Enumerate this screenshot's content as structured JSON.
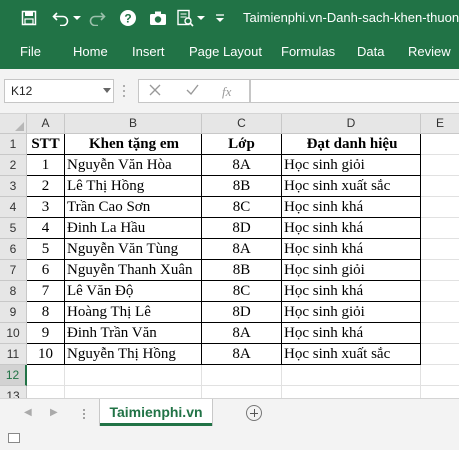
{
  "window": {
    "title": "Taimienphi.vn-Danh-sach-khen-thuong-",
    "quick_access": [
      "save-icon",
      "undo-icon",
      "redo-icon",
      "help-icon",
      "camera-icon",
      "print-preview-icon",
      "customize-icon"
    ]
  },
  "ribbon": {
    "tabs": [
      {
        "label": "File"
      },
      {
        "label": "Home"
      },
      {
        "label": "Insert"
      },
      {
        "label": "Page Layout"
      },
      {
        "label": "Formulas"
      },
      {
        "label": "Data"
      },
      {
        "label": "Review"
      }
    ]
  },
  "formula_bar": {
    "name_box": "K12",
    "fx_symbol": "fx",
    "value": ""
  },
  "grid": {
    "columns": [
      "A",
      "B",
      "C",
      "D",
      "E"
    ],
    "row_numbers": [
      "1",
      "2",
      "3",
      "4",
      "5",
      "6",
      "7",
      "8",
      "9",
      "10",
      "11",
      "12",
      "13"
    ],
    "header": {
      "stt": "STT",
      "name": "Khen tặng em",
      "class": "Lớp",
      "award": "Đạt danh hiệu"
    },
    "rows": [
      {
        "stt": "1",
        "name": "Nguyễn Văn Hòa",
        "class": "8A",
        "award": "Học sinh giỏi"
      },
      {
        "stt": "2",
        "name": "Lê Thị Hồng",
        "class": "8B",
        "award": "Học sinh xuất sắc"
      },
      {
        "stt": "3",
        "name": "Trần Cao Sơn",
        "class": "8C",
        "award": "Học sinh khá"
      },
      {
        "stt": "4",
        "name": "Đinh La Hầu",
        "class": "8D",
        "award": "Học sinh khá"
      },
      {
        "stt": "5",
        "name": "Nguyễn Văn Tùng",
        "class": "8A",
        "award": "Học sinh khá"
      },
      {
        "stt": "6",
        "name": "Nguyễn Thanh Xuân",
        "class": "8B",
        "award": "Học sinh giỏi"
      },
      {
        "stt": "7",
        "name": "Lê Văn Độ",
        "class": "8C",
        "award": "Học sinh khá"
      },
      {
        "stt": "8",
        "name": "Hoàng Thị Lê",
        "class": "8D",
        "award": "Học sinh giỏi"
      },
      {
        "stt": "9",
        "name": "Đinh Trần Văn",
        "class": "8A",
        "award": "Học sinh khá"
      },
      {
        "stt": "10",
        "name": "Nguyễn Thị Hồng",
        "class": "8A",
        "award": "Học sinh xuất sắc"
      }
    ],
    "selected_row": "12"
  },
  "sheets": {
    "tabs": [
      {
        "label": "Taimienphi.vn"
      }
    ],
    "active": 0
  },
  "colors": {
    "accent": "#217346",
    "selection": "#217346"
  }
}
